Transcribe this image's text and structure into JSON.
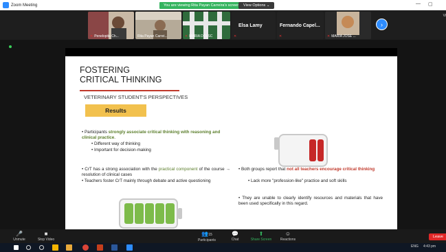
{
  "titlebar": {
    "app": "Zoom Meeting",
    "viewing": "You are viewing Rita Payan Carreira's screen",
    "view_options": "View Options ⌄",
    "min": "—",
    "max": "▢"
  },
  "participants": [
    {
      "name": "Penelopita Ch...",
      "muted": true
    },
    {
      "name": "Rita Payan Carrei...",
      "muted": false
    },
    {
      "name": "MARIA DOLSC",
      "muted": true
    },
    {
      "name": "Elsa Lamy",
      "muted": true
    },
    {
      "name": "Fernando Capel...",
      "muted": true
    },
    {
      "name": "MARIA JOSE ...",
      "muted": true
    }
  ],
  "view_button": "Vi",
  "slide": {
    "title_line1": "FOSTERING",
    "title_line2": "CRITICAL THINKING",
    "subtitle": "VETERINARY STUDENT'S PERSPECTIVES",
    "results": "Results",
    "b1_pre": "• Participants ",
    "b1_green": "strongly associate critical thinking with reasoning and clinical practice",
    "b1_post": ".",
    "b1_sub1": "• Different way of thinking",
    "b1_sub2": "• Important for decision-making",
    "b2_pre": "• CrT has a strong association with the ",
    "b2_green": "practical component",
    "b2_post": " of the course → resolution of clinical cases",
    "b3": "• Teachers foster CrT  mainly through debate and active questioning",
    "r1_pre": "• Both groups report that ",
    "r1_red": "not all teachers encourage critical thinking",
    "r1_sub": "• Lack more \"profession-like\" practice and soft skills",
    "r2": "• They are unable to clearly identify resources and materials that have been used specifically in this regard."
  },
  "toolbar": {
    "unmute": "Unmute",
    "stop_video": "Stop Video",
    "participants": "Participants",
    "participant_count": "15",
    "chat": "Chat",
    "share_screen": "Share Screen",
    "reactions": "Reactions",
    "leave": "Leave"
  },
  "taskbar": {
    "lang": "ENG",
    "time": "4:43 pm"
  },
  "colors": {
    "zoom_blue": "#2d8cff",
    "share_green": "#35b45f",
    "leave_red": "#e02828",
    "slide_green": "#5a7d2a",
    "slide_red": "#c0392b",
    "results_yellow": "#f2c14e"
  }
}
